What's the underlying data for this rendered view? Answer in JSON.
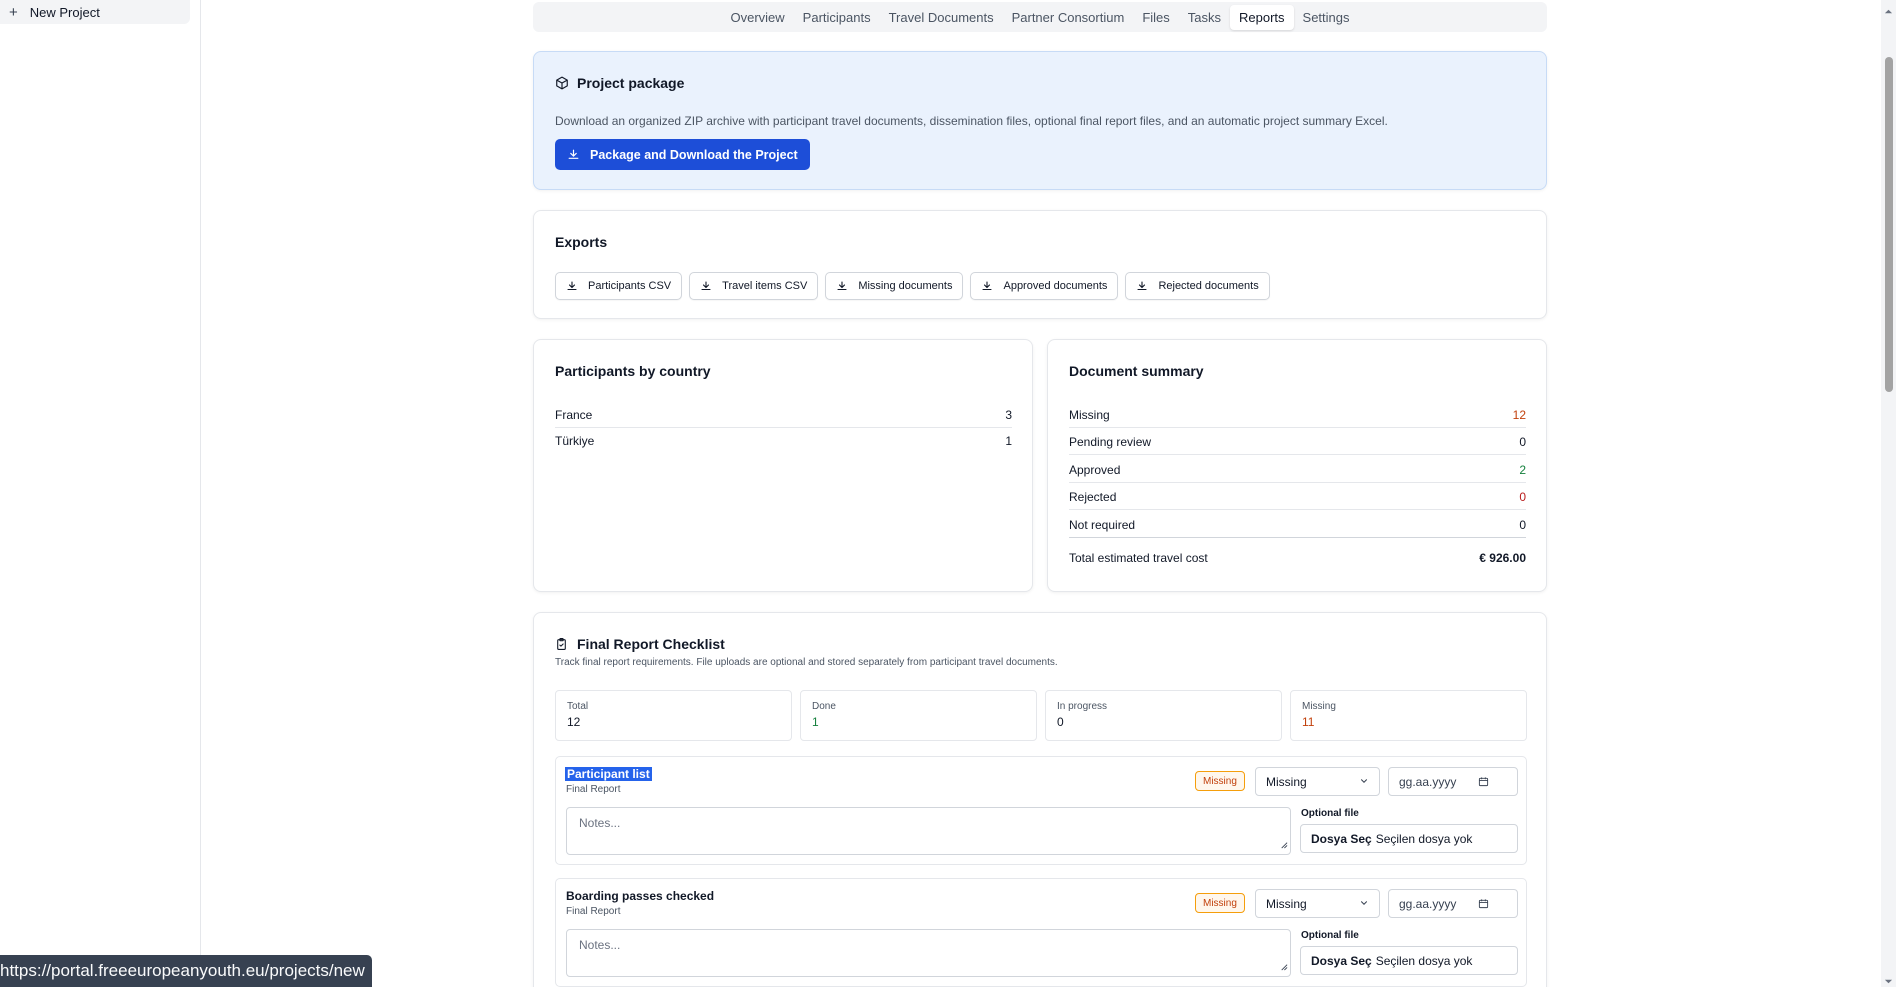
{
  "sidebar": {
    "new_project_label": "New Project"
  },
  "tabs": [
    {
      "label": "Overview",
      "active": false
    },
    {
      "label": "Participants",
      "active": false
    },
    {
      "label": "Travel Documents",
      "active": false
    },
    {
      "label": "Partner Consortium",
      "active": false
    },
    {
      "label": "Files",
      "active": false
    },
    {
      "label": "Tasks",
      "active": false
    },
    {
      "label": "Reports",
      "active": true
    },
    {
      "label": "Settings",
      "active": false
    }
  ],
  "package": {
    "title": "Project package",
    "description": "Download an organized ZIP archive with participant travel documents, dissemination files, optional final report files, and an automatic project summary Excel.",
    "button_label": "Package and Download the Project"
  },
  "exports": {
    "title": "Exports",
    "buttons": [
      "Participants CSV",
      "Travel items CSV",
      "Missing documents",
      "Approved documents",
      "Rejected documents"
    ]
  },
  "by_country": {
    "title": "Participants by country",
    "rows": [
      {
        "label": "France",
        "value": "3"
      },
      {
        "label": "Türkiye",
        "value": "1"
      }
    ]
  },
  "doc_summary": {
    "title": "Document summary",
    "rows": [
      {
        "label": "Missing",
        "value": "12",
        "tone": "orange"
      },
      {
        "label": "Pending review",
        "value": "0",
        "tone": "default"
      },
      {
        "label": "Approved",
        "value": "2",
        "tone": "green"
      },
      {
        "label": "Rejected",
        "value": "0",
        "tone": "red"
      },
      {
        "label": "Not required",
        "value": "0",
        "tone": "default"
      }
    ],
    "total_label": "Total estimated travel cost",
    "total_value": "€ 926.00"
  },
  "checklist": {
    "title": "Final Report Checklist",
    "subtitle": "Track final report requirements. File uploads are optional and stored separately from participant travel documents.",
    "stats": [
      {
        "label": "Total",
        "value": "12",
        "tone": "default"
      },
      {
        "label": "Done",
        "value": "1",
        "tone": "green"
      },
      {
        "label": "In progress",
        "value": "0",
        "tone": "default"
      },
      {
        "label": "Missing",
        "value": "11",
        "tone": "orange"
      }
    ],
    "items": [
      {
        "title": "Participant list",
        "category": "Final Report",
        "badge": "Missing",
        "status": "Missing",
        "date_placeholder": "gg.aa.yyyy",
        "notes_placeholder": "Notes...",
        "optional_file_label": "Optional file",
        "choose_label": "Dosya Seç",
        "no_file_label": "Seçilen dosya yok",
        "selected": true
      },
      {
        "title": "Boarding passes checked",
        "category": "Final Report",
        "badge": "Missing",
        "status": "Missing",
        "date_placeholder": "gg.aa.yyyy",
        "notes_placeholder": "Notes...",
        "optional_file_label": "Optional file",
        "choose_label": "Dosya Seç",
        "no_file_label": "Seçilen dosya yok",
        "selected": false
      }
    ]
  },
  "status_url": "https://portal.freeeuropeanyouth.eu/projects/new",
  "colors": {
    "primary": "#1d4ed8",
    "missing": "#c2410c",
    "approved": "#15803d",
    "rejected": "#b91c1c",
    "package_bg": "#eaf2fd"
  }
}
